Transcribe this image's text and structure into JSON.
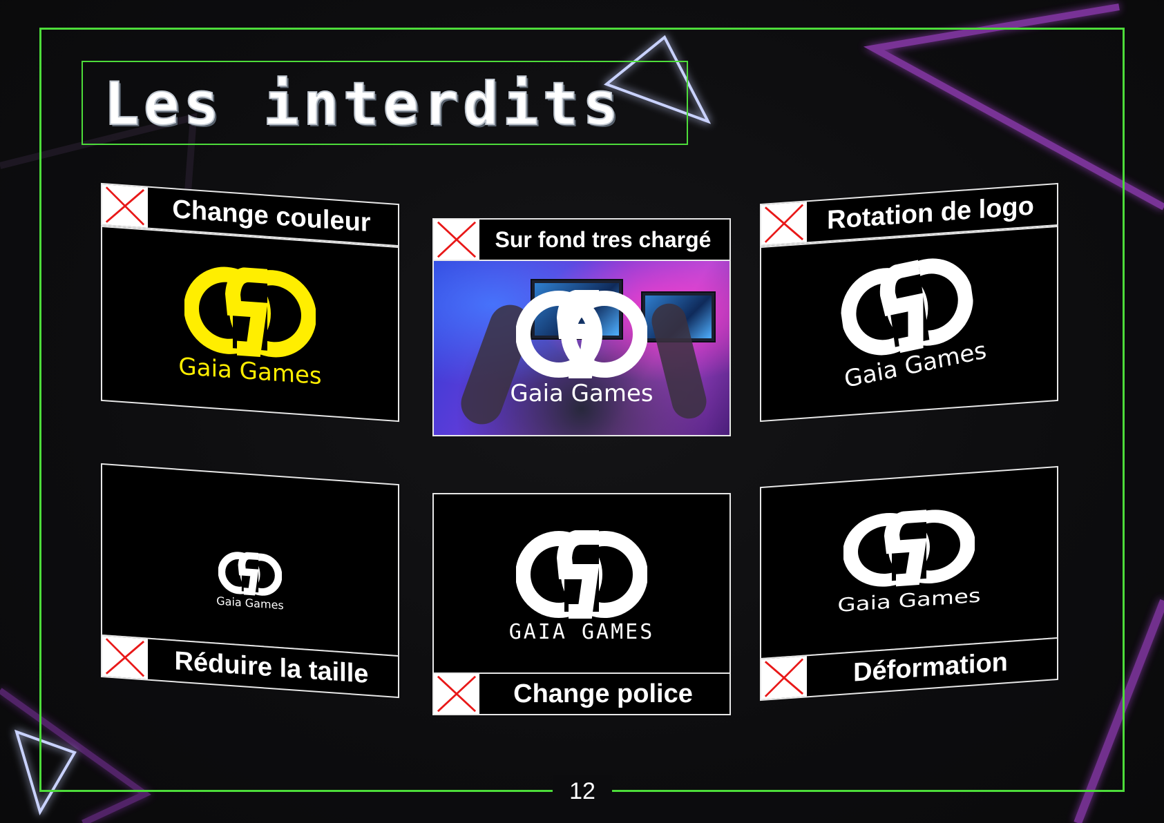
{
  "page": {
    "title": "Les interdits",
    "page_number": "12"
  },
  "colors": {
    "frame_green": "#4ddc3a",
    "neon_purple": "#b54bd8",
    "neon_blue": "#9aa8ff",
    "logo_yellow": "#ffee00",
    "cross_red": "#e81818",
    "panel_bg": "#000000"
  },
  "cards": [
    {
      "label": "Change couleur",
      "brand": "Gaia Games",
      "logo_color": "#ffee00",
      "icon": "cross-icon"
    },
    {
      "label": "Sur fond tres chargé",
      "brand": "Gaia Games",
      "logo_color": "#ffffff",
      "icon": "cross-icon"
    },
    {
      "label": "Rotation de logo",
      "brand": "Gaia Games",
      "logo_color": "#ffffff",
      "icon": "cross-icon"
    },
    {
      "label": "Réduire la taille",
      "brand": "Gaia Games",
      "logo_color": "#ffffff",
      "icon": "cross-icon"
    },
    {
      "label": "Change police",
      "brand": "GAIA GAMES",
      "logo_color": "#ffffff",
      "icon": "cross-icon"
    },
    {
      "label": "Déformation",
      "brand": "Gaia Games",
      "logo_color": "#ffffff",
      "icon": "cross-icon"
    }
  ]
}
